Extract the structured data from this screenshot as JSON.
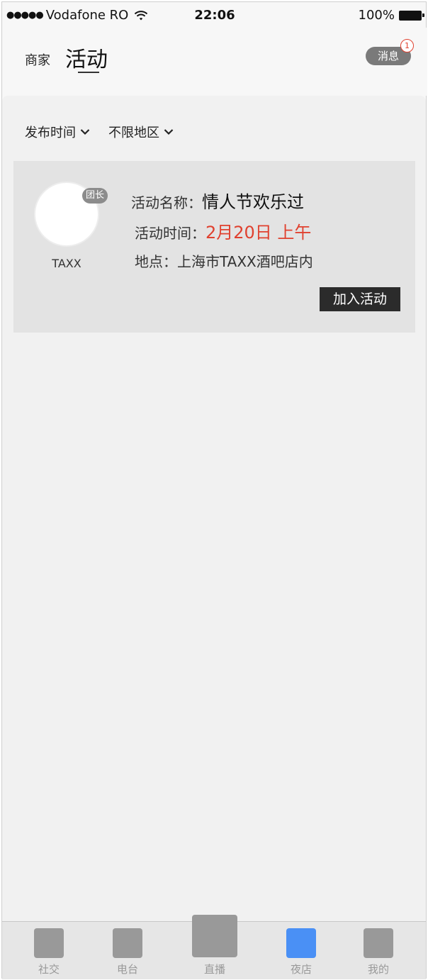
{
  "status_bar": {
    "signal": "●●●●●",
    "carrier": "Vodafone RO",
    "time": "22:06",
    "battery": "100%"
  },
  "header": {
    "tabs": [
      {
        "label": "商家"
      },
      {
        "label": "活动"
      }
    ],
    "message_button": "消息",
    "message_badge": "1"
  },
  "filters": [
    {
      "label": "发布时间"
    },
    {
      "label": "不限地区"
    }
  ],
  "activity": {
    "leader_badge": "团长",
    "host_name": "TAXX",
    "name_label": "活动名称：",
    "name_value": "情人节欢乐过",
    "time_label": "活动时间：",
    "time_value": "2月20日 上午",
    "place_label": "地点：",
    "place_value": "上海市TAXX酒吧店内",
    "join_button": "加入活动"
  },
  "tabbar": {
    "items": [
      {
        "label": "社交",
        "icon": "social-icon"
      },
      {
        "label": "电台",
        "icon": "radio-icon"
      },
      {
        "label": "直播",
        "icon": "live-icon"
      },
      {
        "label": "夜店",
        "icon": "nightclub-icon",
        "active": true
      },
      {
        "label": "我的",
        "icon": "profile-icon"
      }
    ],
    "active_color": "#4a90f5",
    "inactive_color": "#999999"
  }
}
